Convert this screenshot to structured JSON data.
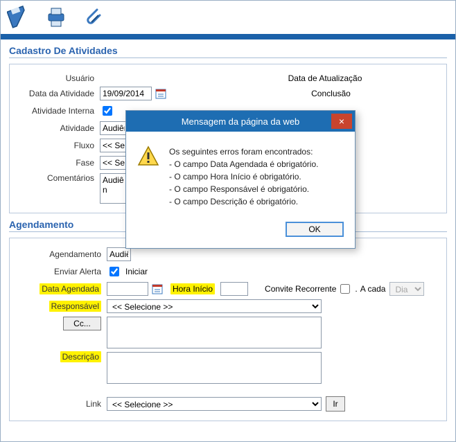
{
  "toolbar": {
    "icons": {
      "save": "save-icon",
      "print": "print-icon",
      "attach": "attach-icon"
    }
  },
  "sections": {
    "cadastro": {
      "title": "Cadastro De Atividades",
      "usuario": "Usuário",
      "data_atividade_label": "Data da Atividade",
      "data_atividade_value": "19/09/2014",
      "atividade_interna_label": "Atividade Interna",
      "atividade_interna_checked": true,
      "atividade_label": "Atividade",
      "atividade_value": "Audiên",
      "fluxo_label": "Fluxo",
      "fluxo_placeholder": "<< Sele",
      "fase_label": "Fase",
      "fase_placeholder": "<< Sele",
      "comentarios_label": "Comentários",
      "comentarios_value": "Audiên",
      "data_atualizacao_label": "Data de Atualização",
      "conclusao_label": "Conclusão"
    },
    "agendamento": {
      "title": "Agendamento",
      "agendamento_label": "Agendamento",
      "agendamento_value": "Audiê",
      "enviar_alerta_label": "Enviar Alerta",
      "enviar_alerta_checked": true,
      "iniciar_label": "Iniciar",
      "data_agendada_label": "Data Agendada",
      "data_agendada_value": "",
      "hora_inicio_label": "Hora Início",
      "hora_inicio_value": "",
      "convite_label": "Convite Recorrente",
      "a_cada_label": "A cada",
      "periodo_value": "Dia",
      "responsavel_label": "Responsável",
      "responsavel_placeholder": "<< Selecione >>",
      "cc_label": "Cc...",
      "descricao_label": "Descrição",
      "link_label": "Link",
      "link_placeholder": "<< Selecione >>",
      "ir_label": "Ir"
    }
  },
  "modal": {
    "title": "Mensagem da página da web",
    "heading": "Os seguintes erros foram encontrados:",
    "errors": [
      "- O campo Data Agendada é obrigatório.",
      "- O campo Hora Início é obrigatório.",
      "- O campo Responsável é obrigatório.",
      "- O campo Descrição é obrigatório."
    ],
    "ok": "OK",
    "close": "×"
  }
}
